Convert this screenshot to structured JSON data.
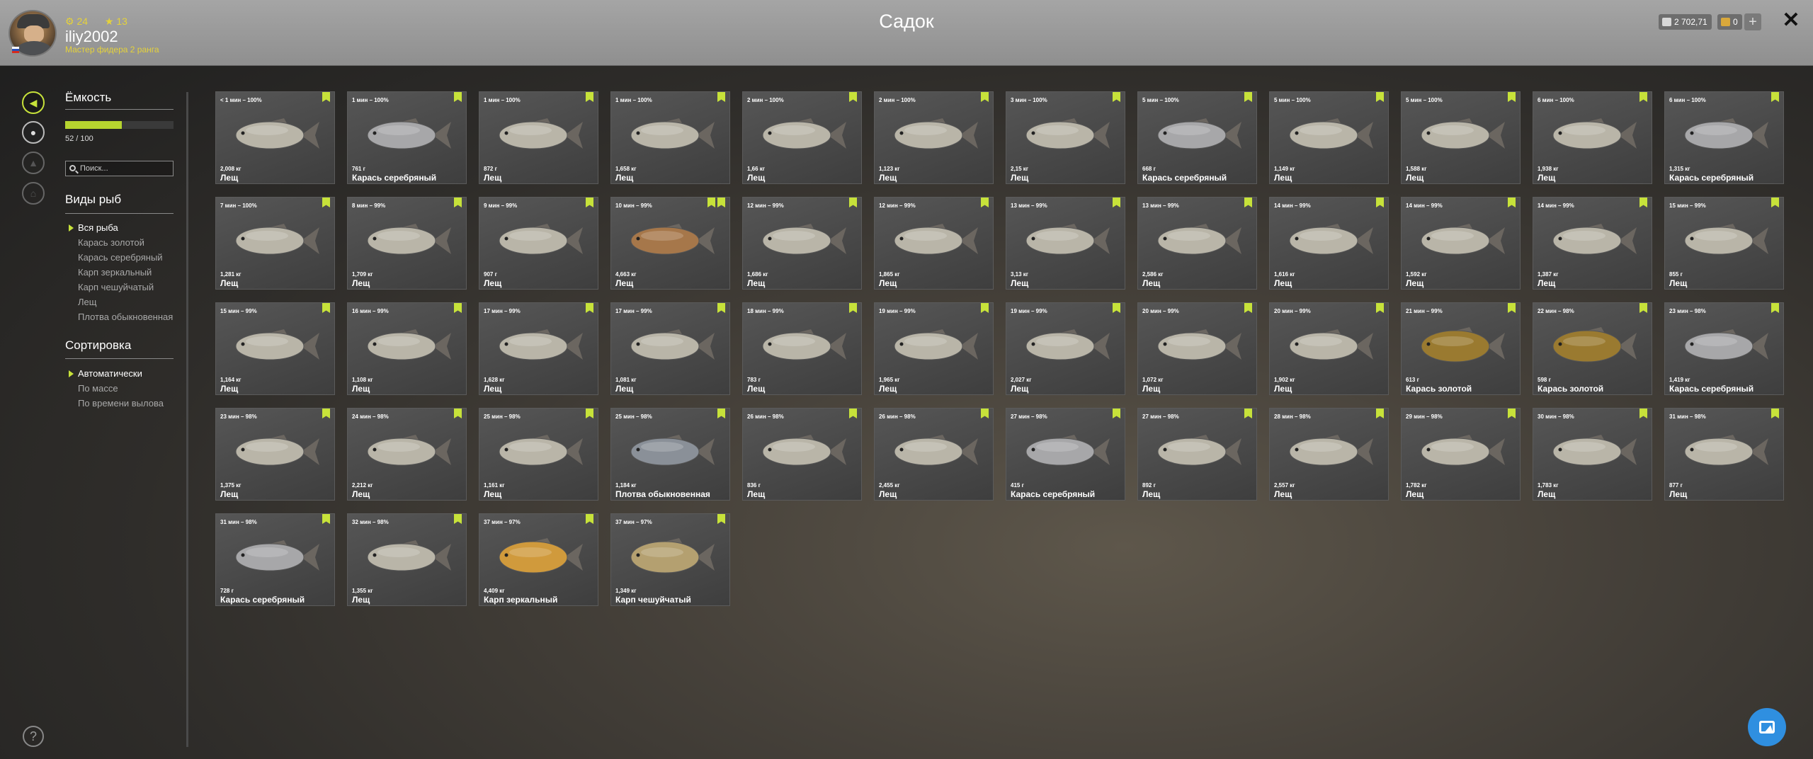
{
  "header": {
    "title": "Садок",
    "user": {
      "stat_a": "24",
      "stat_b": "13",
      "name": "iliy2002",
      "rank": "Мастер фидера 2 ранга"
    },
    "silver": "2 702,71",
    "gold": "0",
    "plus_label": "+",
    "close_label": "✕"
  },
  "sidebar": {
    "capacity_title": "Ёмкость",
    "capacity_used": 52,
    "capacity_total": 100,
    "capacity_text": "52 / 100",
    "search_placeholder": "Поиск...",
    "species_title": "Виды рыб",
    "species": [
      "Вся рыба",
      "Карась золотой",
      "Карась серебряный",
      "Карп зеркальный",
      "Карп чешуйчатый",
      "Лещ",
      "Плотва обыкновенная"
    ],
    "species_selected": 0,
    "sort_title": "Сортировка",
    "sort": [
      "Автоматически",
      "По массе",
      "По времени вылова"
    ],
    "sort_selected": 0
  },
  "rail_icons": [
    "exit-icon",
    "keepnet-icon",
    "fire-icon",
    "home-icon"
  ],
  "help_label": "?",
  "colors": {
    "accent": "#c7e23a",
    "bream": "#b9b5a8",
    "silver_carp": "#a7a7a9",
    "golden_carp": "#9a7a30",
    "mirror_carp": "#d09a3c",
    "common_carp": "#b4a070",
    "roach": "#8a9098"
  },
  "fish": [
    {
      "time": "< 1 мин – 100%",
      "weight": "2,008 кг",
      "name": "Лещ",
      "kind": "bream"
    },
    {
      "time": "1 мин – 100%",
      "weight": "761 г",
      "name": "Карась серебряный",
      "kind": "silver_carp"
    },
    {
      "time": "1 мин – 100%",
      "weight": "872 г",
      "name": "Лещ",
      "kind": "bream"
    },
    {
      "time": "1 мин – 100%",
      "weight": "1,658 кг",
      "name": "Лещ",
      "kind": "bream"
    },
    {
      "time": "2 мин – 100%",
      "weight": "1,66 кг",
      "name": "Лещ",
      "kind": "bream"
    },
    {
      "time": "2 мин – 100%",
      "weight": "1,123 кг",
      "name": "Лещ",
      "kind": "bream"
    },
    {
      "time": "3 мин – 100%",
      "weight": "2,15 кг",
      "name": "Лещ",
      "kind": "bream"
    },
    {
      "time": "5 мин – 100%",
      "weight": "668 г",
      "name": "Карась серебряный",
      "kind": "silver_carp"
    },
    {
      "time": "5 мин – 100%",
      "weight": "1,149 кг",
      "name": "Лещ",
      "kind": "bream"
    },
    {
      "time": "5 мин – 100%",
      "weight": "1,588 кг",
      "name": "Лещ",
      "kind": "bream"
    },
    {
      "time": "6 мин – 100%",
      "weight": "1,938 кг",
      "name": "Лещ",
      "kind": "bream"
    },
    {
      "time": "6 мин – 100%",
      "weight": "1,315 кг",
      "name": "Карась серебряный",
      "kind": "silver_carp"
    },
    {
      "time": "7 мин – 100%",
      "weight": "1,281 кг",
      "name": "Лещ",
      "kind": "bream"
    },
    {
      "time": "8 мин – 99%",
      "weight": "1,709 кг",
      "name": "Лещ",
      "kind": "bream"
    },
    {
      "time": "9 мин – 99%",
      "weight": "907 г",
      "name": "Лещ",
      "kind": "bream"
    },
    {
      "time": "10 мин – 99%",
      "weight": "4,663 кг",
      "name": "Лещ",
      "kind": "bream_big",
      "double_badge": true
    },
    {
      "time": "12 мин – 99%",
      "weight": "1,686 кг",
      "name": "Лещ",
      "kind": "bream"
    },
    {
      "time": "12 мин – 99%",
      "weight": "1,865 кг",
      "name": "Лещ",
      "kind": "bream"
    },
    {
      "time": "13 мин – 99%",
      "weight": "3,13 кг",
      "name": "Лещ",
      "kind": "bream"
    },
    {
      "time": "13 мин – 99%",
      "weight": "2,586 кг",
      "name": "Лещ",
      "kind": "bream"
    },
    {
      "time": "14 мин – 99%",
      "weight": "1,616 кг",
      "name": "Лещ",
      "kind": "bream"
    },
    {
      "time": "14 мин – 99%",
      "weight": "1,592 кг",
      "name": "Лещ",
      "kind": "bream"
    },
    {
      "time": "14 мин – 99%",
      "weight": "1,387 кг",
      "name": "Лещ",
      "kind": "bream"
    },
    {
      "time": "15 мин – 99%",
      "weight": "855 г",
      "name": "Лещ",
      "kind": "bream"
    },
    {
      "time": "15 мин – 99%",
      "weight": "1,164 кг",
      "name": "Лещ",
      "kind": "bream"
    },
    {
      "time": "16 мин – 99%",
      "weight": "1,108 кг",
      "name": "Лещ",
      "kind": "bream"
    },
    {
      "time": "17 мин – 99%",
      "weight": "1,628 кг",
      "name": "Лещ",
      "kind": "bream"
    },
    {
      "time": "17 мин – 99%",
      "weight": "1,081 кг",
      "name": "Лещ",
      "kind": "bream"
    },
    {
      "time": "18 мин – 99%",
      "weight": "783 г",
      "name": "Лещ",
      "kind": "bream"
    },
    {
      "time": "19 мин – 99%",
      "weight": "1,965 кг",
      "name": "Лещ",
      "kind": "bream"
    },
    {
      "time": "19 мин – 99%",
      "weight": "2,027 кг",
      "name": "Лещ",
      "kind": "bream"
    },
    {
      "time": "20 мин – 99%",
      "weight": "1,072 кг",
      "name": "Лещ",
      "kind": "bream"
    },
    {
      "time": "20 мин – 99%",
      "weight": "1,902 кг",
      "name": "Лещ",
      "kind": "bream"
    },
    {
      "time": "21 мин – 99%",
      "weight": "613 г",
      "name": "Карась золотой",
      "kind": "golden_carp"
    },
    {
      "time": "22 мин – 98%",
      "weight": "598 г",
      "name": "Карась золотой",
      "kind": "golden_carp"
    },
    {
      "time": "23 мин – 98%",
      "weight": "1,419 кг",
      "name": "Карась серебряный",
      "kind": "silver_carp"
    },
    {
      "time": "23 мин – 98%",
      "weight": "1,375 кг",
      "name": "Лещ",
      "kind": "bream"
    },
    {
      "time": "24 мин – 98%",
      "weight": "2,212 кг",
      "name": "Лещ",
      "kind": "bream"
    },
    {
      "time": "25 мин – 98%",
      "weight": "1,161 кг",
      "name": "Лещ",
      "kind": "bream"
    },
    {
      "time": "25 мин – 98%",
      "weight": "1,184 кг",
      "name": "Плотва обыкновенная",
      "kind": "roach"
    },
    {
      "time": "26 мин – 98%",
      "weight": "836 г",
      "name": "Лещ",
      "kind": "bream"
    },
    {
      "time": "26 мин – 98%",
      "weight": "2,455 кг",
      "name": "Лещ",
      "kind": "bream"
    },
    {
      "time": "27 мин – 98%",
      "weight": "415 г",
      "name": "Карась серебряный",
      "kind": "silver_carp"
    },
    {
      "time": "27 мин – 98%",
      "weight": "892 г",
      "name": "Лещ",
      "kind": "bream"
    },
    {
      "time": "28 мин – 98%",
      "weight": "2,557 кг",
      "name": "Лещ",
      "kind": "bream"
    },
    {
      "time": "29 мин – 98%",
      "weight": "1,782 кг",
      "name": "Лещ",
      "kind": "bream"
    },
    {
      "time": "30 мин – 98%",
      "weight": "1,783 кг",
      "name": "Лещ",
      "kind": "bream"
    },
    {
      "time": "31 мин – 98%",
      "weight": "877 г",
      "name": "Лещ",
      "kind": "bream"
    },
    {
      "time": "31 мин – 98%",
      "weight": "728 г",
      "name": "Карась серебряный",
      "kind": "silver_carp"
    },
    {
      "time": "32 мин – 98%",
      "weight": "1,355 кг",
      "name": "Лещ",
      "kind": "bream"
    },
    {
      "time": "37 мин – 97%",
      "weight": "4,409 кг",
      "name": "Карп зеркальный",
      "kind": "mirror_carp"
    },
    {
      "time": "37 мин – 97%",
      "weight": "1,349 кг",
      "name": "Карп чешуйчатый",
      "kind": "common_carp"
    }
  ]
}
